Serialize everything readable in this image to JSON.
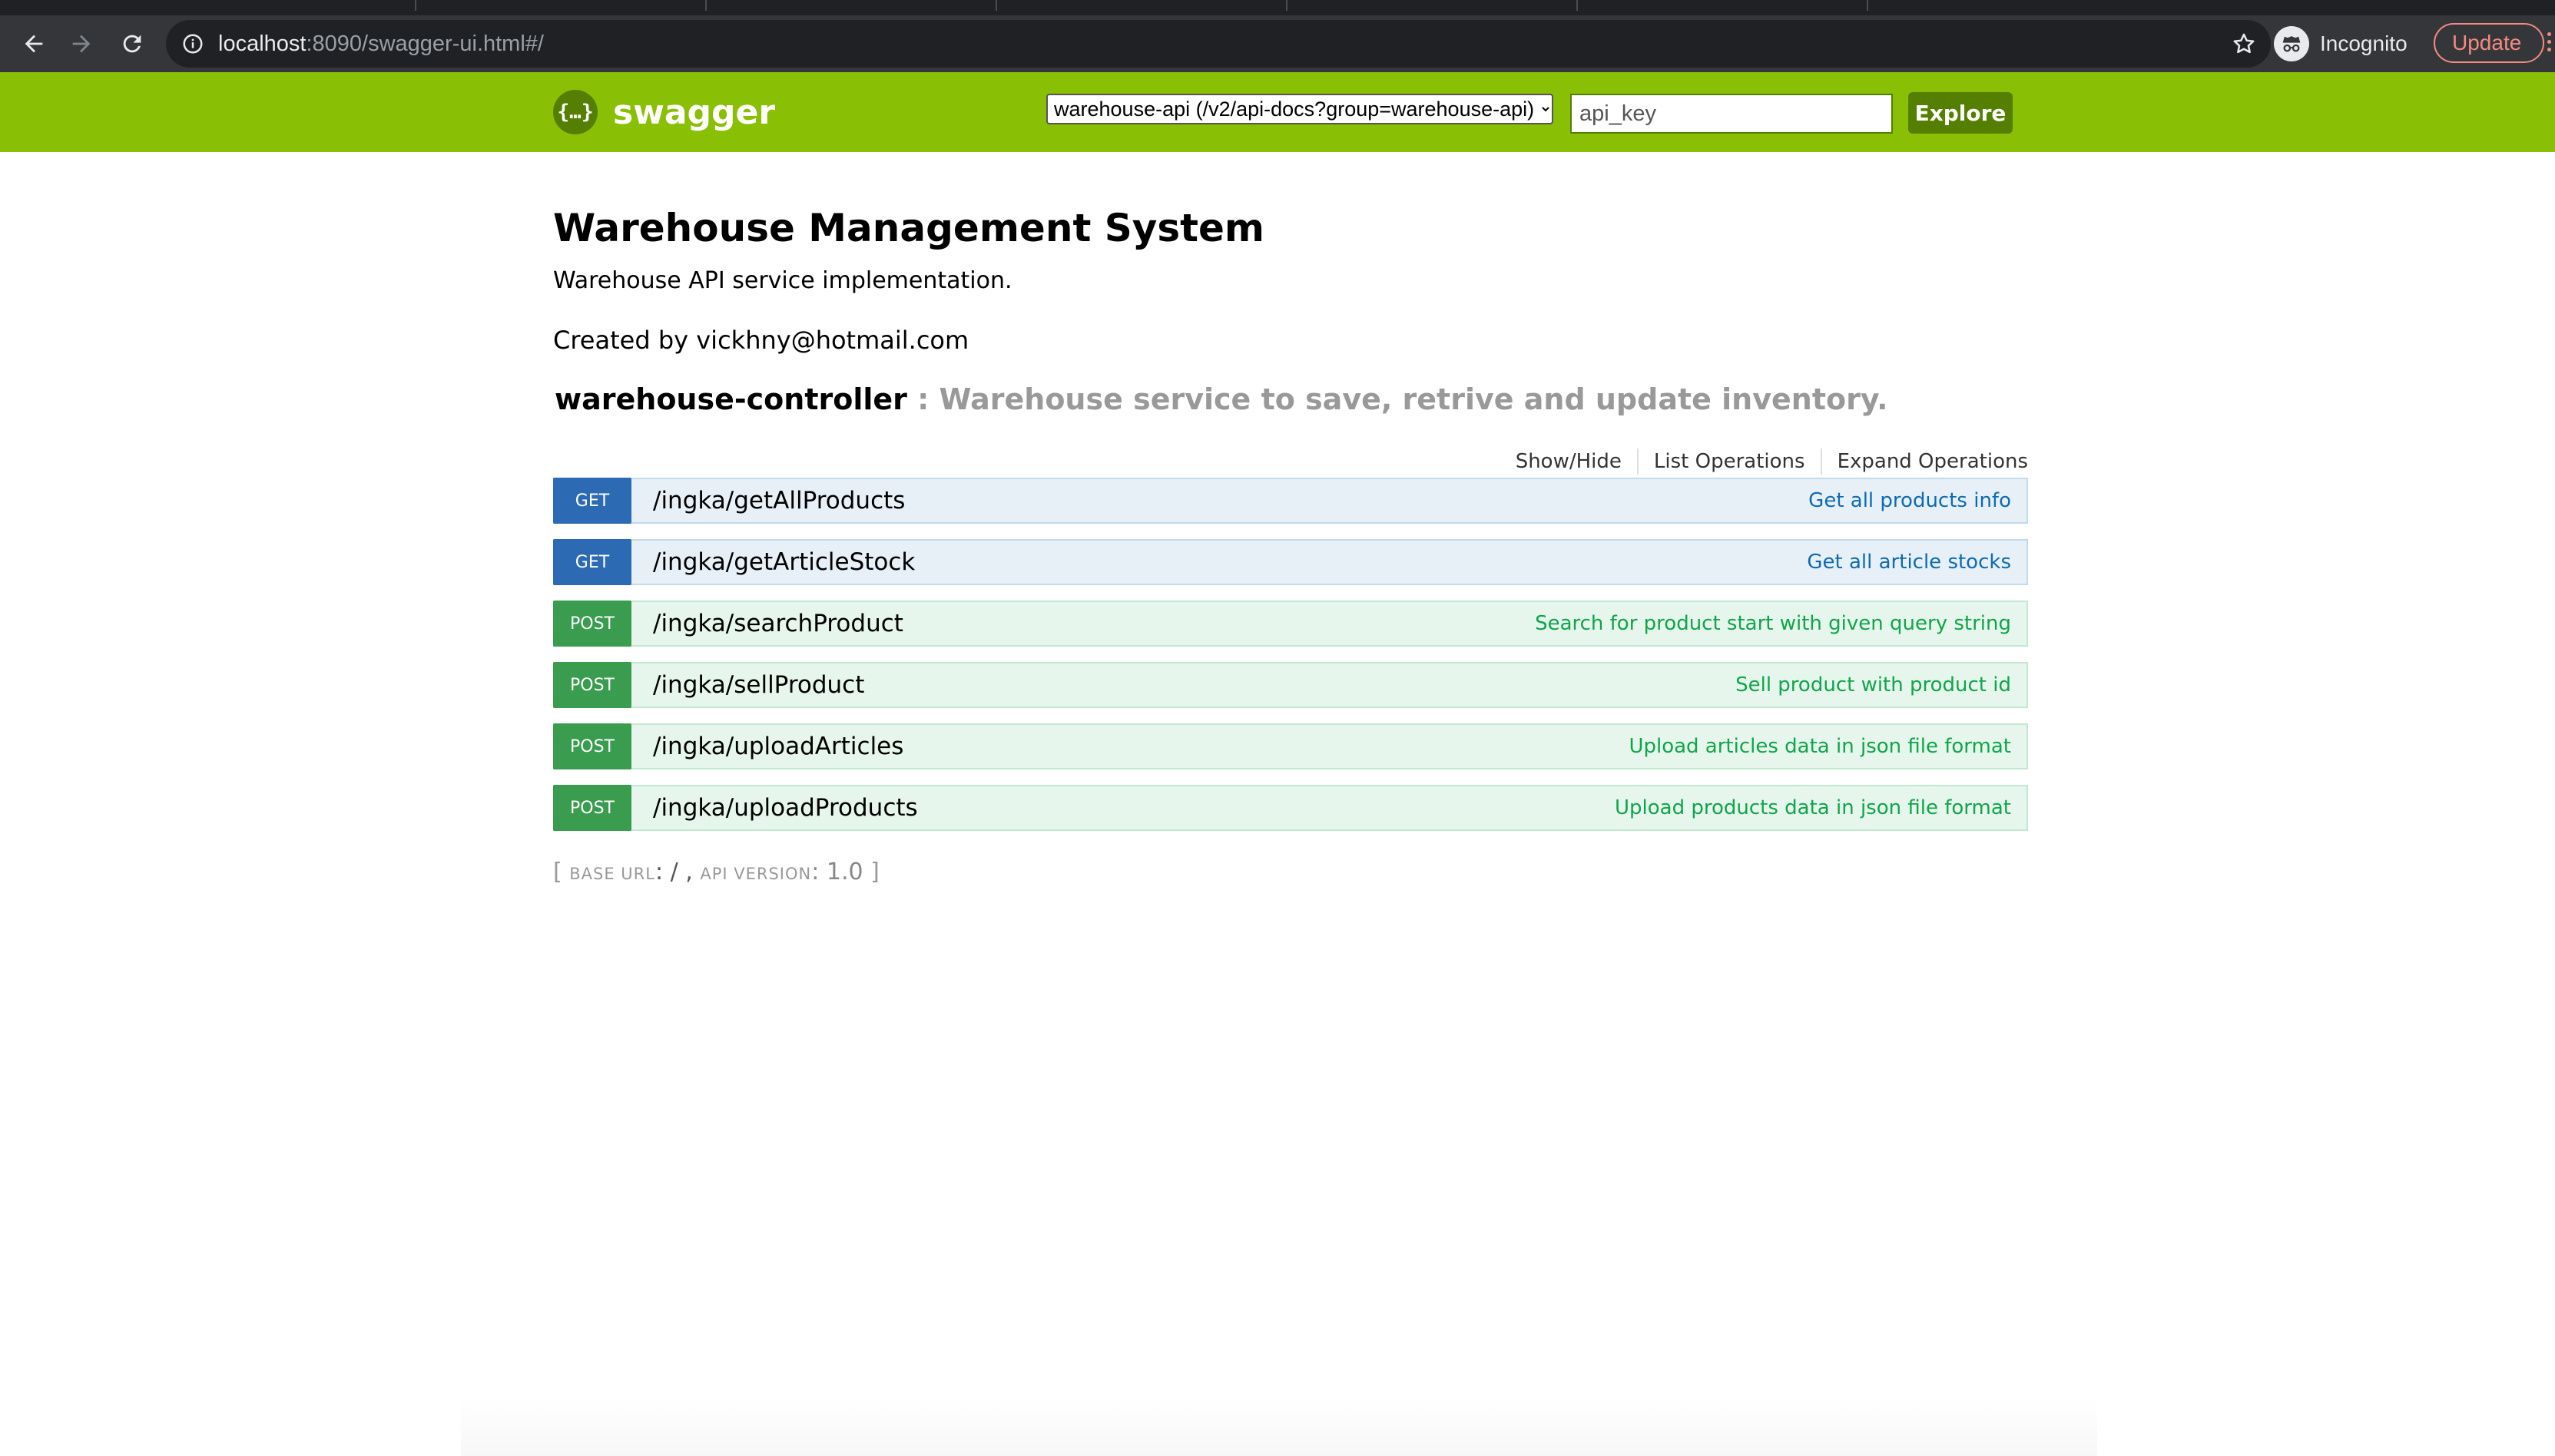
{
  "browser": {
    "url_host": "localhost",
    "url_rest": ":8090/swagger-ui.html#/",
    "profile_label": "Incognito",
    "update_label": "Update"
  },
  "header": {
    "logo_text": "swagger",
    "logo_glyph": "{…}",
    "api_select_value": "warehouse-api (/v2/api-docs?group=warehouse-api)",
    "api_key_placeholder": "api_key",
    "explore_label": "Explore",
    "brand_color": "#89bf04"
  },
  "info": {
    "title": "Warehouse Management System",
    "description": "Warehouse API service implementation.",
    "created_by": "Created by vickhny@hotmail.com"
  },
  "resource": {
    "name": "warehouse-controller",
    "description": " : Warehouse service to save, retrive and update inventory.",
    "actions": {
      "show_hide": "Show/Hide",
      "list_operations": "List Operations",
      "expand_operations": "Expand Operations"
    }
  },
  "operations": [
    {
      "method": "GET",
      "path": "/ingka/getAllProducts",
      "summary": "Get all products info"
    },
    {
      "method": "GET",
      "path": "/ingka/getArticleStock",
      "summary": "Get all article stocks"
    },
    {
      "method": "POST",
      "path": "/ingka/searchProduct",
      "summary": "Search for product start with given query string"
    },
    {
      "method": "POST",
      "path": "/ingka/sellProduct",
      "summary": "Sell product with product id"
    },
    {
      "method": "POST",
      "path": "/ingka/uploadArticles",
      "summary": "Upload articles data in json file format"
    },
    {
      "method": "POST",
      "path": "/ingka/uploadProducts",
      "summary": "Upload products data in json file format"
    }
  ],
  "footer": {
    "open_bracket": "[ ",
    "base_url_label": "base url",
    "base_url_value": ": / , ",
    "api_version_label": "api version",
    "api_version_value": ": 1.0",
    "close_bracket": " ]"
  }
}
